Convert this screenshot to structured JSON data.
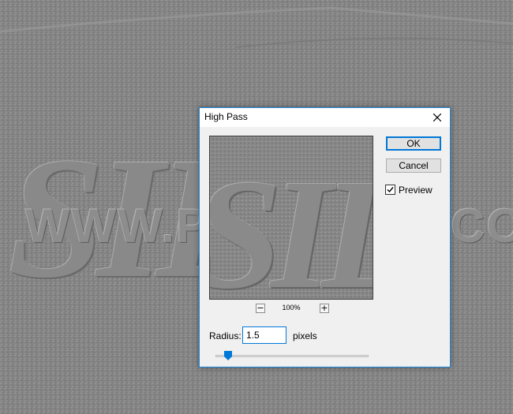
{
  "background": {
    "watermark_text": "WWW.PSD-DUDE.COM",
    "decorative_letters": "SIL"
  },
  "dialog": {
    "title": "High Pass",
    "close_icon": "close-icon",
    "preview": {
      "letters": "SIL",
      "zoom_out_label": "−",
      "zoom_in_label": "+",
      "zoom_level": "100%"
    },
    "ok_label": "OK",
    "cancel_label": "Cancel",
    "preview_checkbox": {
      "label": "Preview",
      "checked": true
    },
    "radius": {
      "label": "Radius:",
      "value": "1.5",
      "unit": "pixels",
      "slider_fraction": 0.08
    }
  },
  "colors": {
    "accent": "#0078d7",
    "dialog_border": "#1883d7",
    "dialog_bg": "#f0f0f0",
    "canvas_gray": "#858585"
  }
}
